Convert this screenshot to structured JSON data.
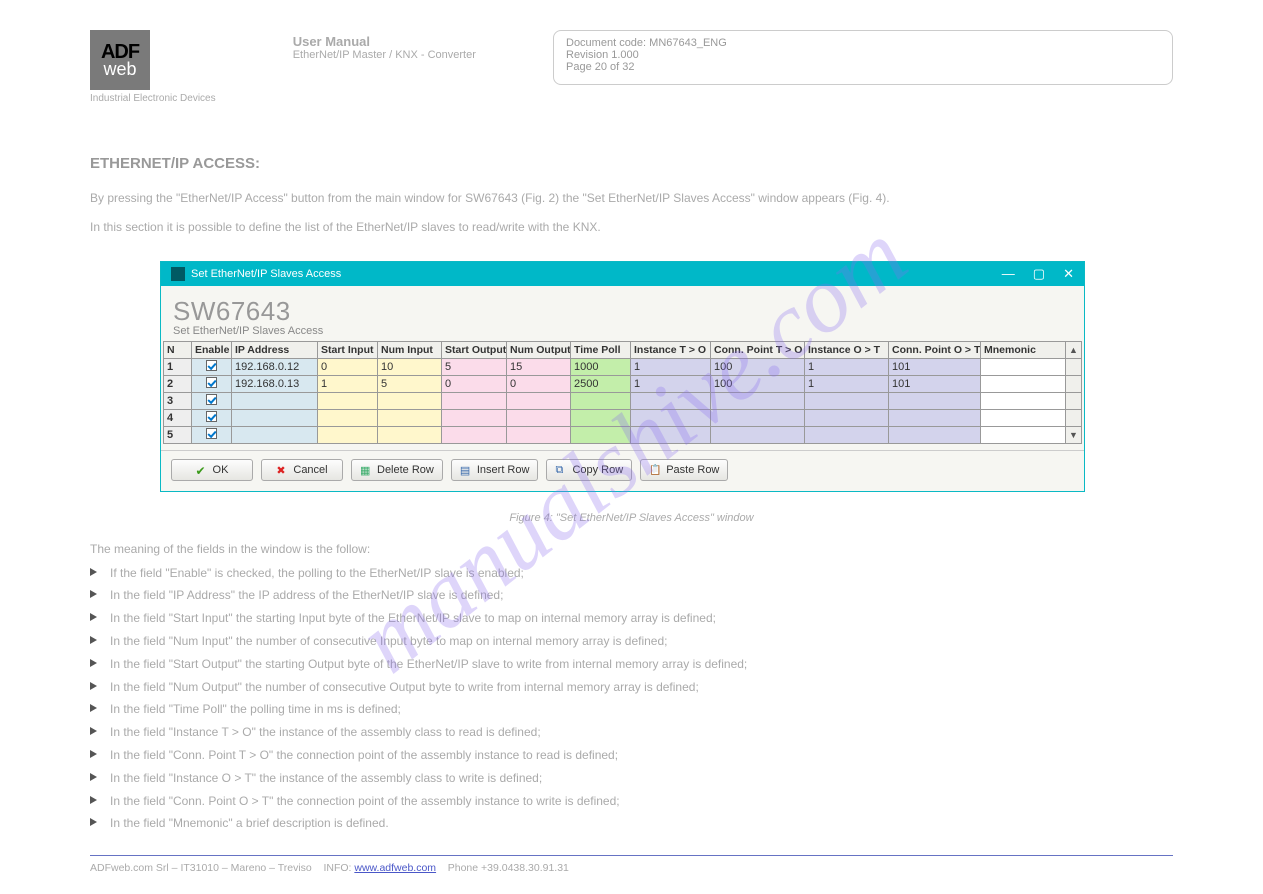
{
  "logo": {
    "line1": "ADF",
    "line2": "web"
  },
  "header": {
    "under_logo_l1": "Industrial Electronic Devices",
    "title_l1": "User Manual",
    "title_l2": "EtherNet/IP Master / KNX - Converter",
    "box_l1": "Document code: MN67643_ENG",
    "box_l2": "Revision 1.000",
    "box_l3": "Page 20 of 32"
  },
  "section_title": "ETHERNET/IP ACCESS:",
  "para1": "By pressing the \"EtherNet/IP Access\" button from the main window for SW67643 (Fig. 2) the \"Set EtherNet/IP Slaves Access\" window appears (Fig. 4).",
  "para2": "In this section it is possible to define the list of the EtherNet/IP slaves to read/write with the KNX.",
  "window": {
    "title": "Set EtherNet/IP Slaves Access",
    "h1": "SW67643",
    "h2": "Set EtherNet/IP Slaves Access",
    "columns": [
      "N",
      "Enable",
      "IP Address",
      "Start Input",
      "Num Input",
      "Start Output",
      "Num Output",
      "Time Poll",
      "Instance T > O",
      "Conn. Point T > O",
      "Instance O > T",
      "Conn. Point O > T",
      "Mnemonic"
    ],
    "rows": [
      {
        "n": "1",
        "en": true,
        "ip": "192.168.0.12",
        "si": "0",
        "ni": "10",
        "so": "5",
        "no": "15",
        "tp": "1000",
        "ito": "1",
        "cpt": "100",
        "iot": "1",
        "cpo": "101",
        "mn": ""
      },
      {
        "n": "2",
        "en": true,
        "ip": "192.168.0.13",
        "si": "1",
        "ni": "5",
        "so": "0",
        "no": "0",
        "tp": "2500",
        "ito": "1",
        "cpt": "100",
        "iot": "1",
        "cpo": "101",
        "mn": ""
      },
      {
        "n": "3",
        "en": true,
        "ip": "",
        "si": "",
        "ni": "",
        "so": "",
        "no": "",
        "tp": "",
        "ito": "",
        "cpt": "",
        "iot": "",
        "cpo": "",
        "mn": ""
      },
      {
        "n": "4",
        "en": true,
        "ip": "",
        "si": "",
        "ni": "",
        "so": "",
        "no": "",
        "tp": "",
        "ito": "",
        "cpt": "",
        "iot": "",
        "cpo": "",
        "mn": ""
      },
      {
        "n": "5",
        "en": true,
        "ip": "",
        "si": "",
        "ni": "",
        "so": "",
        "no": "",
        "tp": "",
        "ito": "",
        "cpt": "",
        "iot": "",
        "cpo": "",
        "mn": ""
      }
    ],
    "buttons": {
      "ok": "OK",
      "cancel": "Cancel",
      "del": "Delete Row",
      "ins": "Insert Row",
      "copy": "Copy Row",
      "paste": "Paste Row"
    }
  },
  "figcap": "Figure 4: \"Set EtherNet/IP Slaves Access\" window",
  "meaning_intro": "The meaning of the fields in the window is the follow:",
  "bullets": [
    "If the field \"Enable\" is checked, the polling to the EtherNet/IP slave is enabled;",
    "In the field \"IP Address\" the IP address of the EtherNet/IP slave is defined;",
    "In the field \"Start Input\" the starting Input byte of the EtherNet/IP slave to map on internal memory array is defined;",
    "In the field \"Num Input\" the number of consecutive Input byte to map on internal memory array is defined;",
    "In the field \"Start Output\" the starting Output byte of the EtherNet/IP slave to write from internal memory array is defined;",
    "In the field \"Num Output\" the number of consecutive Output byte to write from internal memory array is defined;",
    "In the field \"Time Poll\" the polling time in ms is defined;",
    "In the field \"Instance T > O\" the instance of the assembly class to read is defined;",
    "In the field \"Conn. Point T > O\" the connection point of the assembly instance to read is defined;",
    "In the field \"Instance O > T\" the instance of the assembly class to write is defined;",
    "In the field \"Conn. Point O > T\" the connection point of the assembly instance to write is defined;",
    "In the field \"Mnemonic\" a brief description is defined."
  ],
  "footer": {
    "left_l1": "ADFweb.com Srl – IT31010 – Mareno – Treviso",
    "left_l2": "INFO:",
    "link": "www.adfweb.com",
    "left_l3": "Phone +39.0438.30.91.31"
  },
  "watermark": "manualshive.com"
}
